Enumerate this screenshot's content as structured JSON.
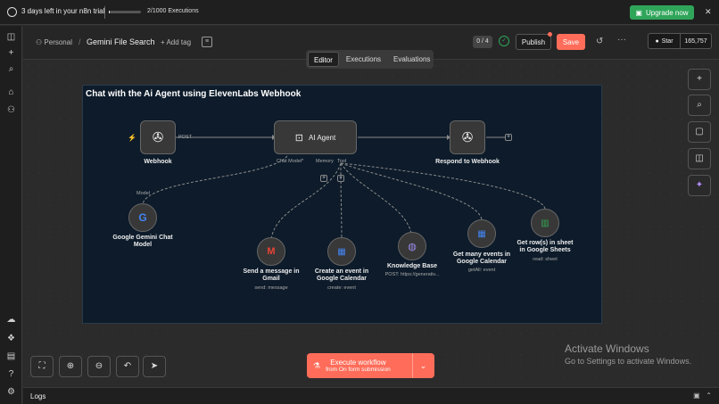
{
  "topbar": {
    "trial_text": "3 days left in your n8n trial",
    "trial_progress": 0.02,
    "executions": "2/1000 Executions",
    "upgrade_label": "Upgrade now"
  },
  "header": {
    "project": "Personal",
    "title": "Gemini File Search",
    "add_tag": "+ Add tag",
    "counter": "0 / 4",
    "publish": "Publish",
    "save": "Save",
    "star": "Star",
    "star_count": "165,757"
  },
  "tabs": [
    {
      "label": "Editor",
      "active": true
    },
    {
      "label": "Executions",
      "active": false
    },
    {
      "label": "Evaluations",
      "active": false
    }
  ],
  "canvas": {
    "sticky_title": "Chat with the Ai Agent using ElevenLabs Webhook",
    "nodes": {
      "webhook": {
        "label": "Webhook",
        "port": "POST"
      },
      "agent": {
        "label": "AI Agent",
        "ports": [
          "Chat Model*",
          "Memory",
          "Tool"
        ]
      },
      "respond": {
        "label": "Respond to Webhook"
      },
      "gemini": {
        "label": "Google Gemini Chat Model",
        "port": "Model"
      },
      "gmail": {
        "label": "Send a message in Gmail",
        "sub": "send: message"
      },
      "calendar_create": {
        "label": "Create an event in Google Calendar",
        "sub": "create: event"
      },
      "kb": {
        "label": "Knowledge Base",
        "sub": "POST: https://generativ..."
      },
      "calendar_get": {
        "label": "Get many events in Google Calendar",
        "sub": "getAll: event"
      },
      "sheets": {
        "label": "Get row(s) in sheet in Google Sheets",
        "sub": "read: sheet"
      }
    }
  },
  "execute": {
    "line1": "Execute workflow",
    "line2": "from On form submission"
  },
  "watermark": {
    "line1": "Activate Windows",
    "line2": "Go to Settings to activate Windows."
  },
  "logs": {
    "label": "Logs"
  },
  "colors": {
    "accent": "#ff6d5a",
    "upgrade": "#2fa55a",
    "sticky": "#0d1b2a"
  }
}
